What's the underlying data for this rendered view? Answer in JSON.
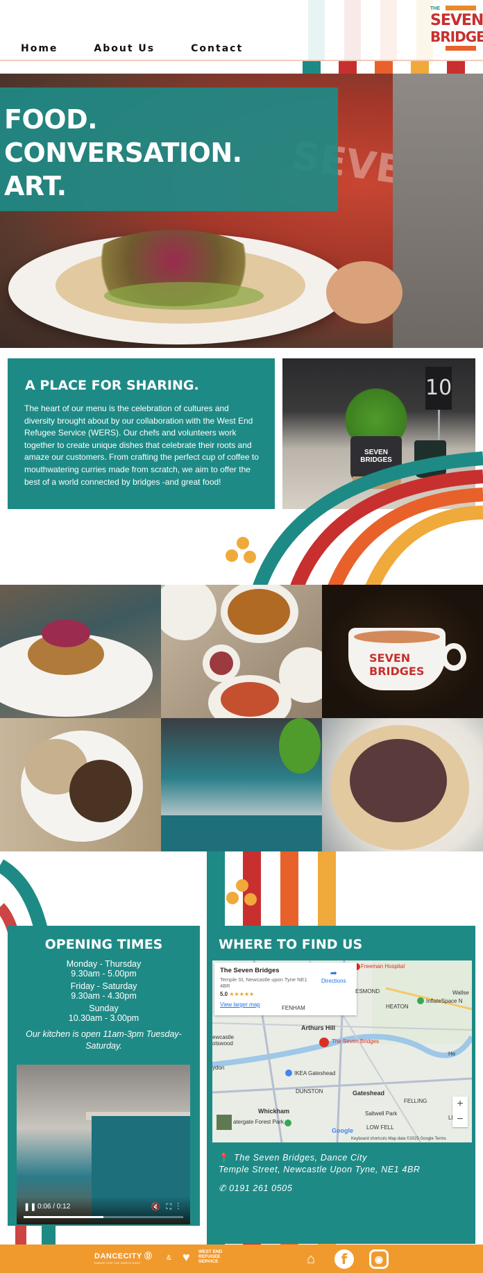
{
  "nav": {
    "items": [
      "Home",
      "About Us",
      "Contact"
    ]
  },
  "logo": {
    "small": "THE",
    "line1": "SEVEN",
    "line2": "BRIDGES"
  },
  "hero": {
    "lines": [
      "FOOD.",
      "CONVERSATION.",
      "ART."
    ],
    "apron_text": "SEVEN"
  },
  "sharing": {
    "title": "A PLACE FOR SHARING.",
    "body": "The heart of our menu is the celebration of cultures and diversity brought about by our collaboration with the West End Refugee Service (WERS). Our chefs and volunteers work together to create unique dishes that celebrate their roots and amaze our customers. From crafting the perfect cup of coffee to mouthwatering curries made from scratch, we aim to offer the best of a world connected by bridges -and great food!",
    "table_number": "10",
    "pot_label": "SEVEN BRIDGES"
  },
  "gallery": {
    "mug_text": "SEVEN BRIDGES"
  },
  "opening": {
    "title": "OPENING TIMES",
    "rows": [
      {
        "days": "Monday - Thursday",
        "hours": "9.30am - 5.00pm"
      },
      {
        "days": "Friday - Saturday",
        "hours": "9.30am - 4.30pm"
      },
      {
        "days": "Sunday",
        "hours": "10.30am - 3.00pm"
      }
    ],
    "note": "Our kitchen is open 11am-3pm Tuesday-Saturday.",
    "video": {
      "time": "0:06 / 0:12",
      "progress": 0.5
    }
  },
  "where": {
    "title": "WHERE TO FIND US",
    "map": {
      "place_name": "The Seven Bridges",
      "place_address": "Temple St, Newcastle upon Tyne NE1 4BR",
      "rating": "5.0",
      "stars": "★★★★★",
      "larger_map": "View larger map",
      "directions": "Directions",
      "labels": {
        "hospital": "Freeman Hospital",
        "jesmond": "ESMOND",
        "wallsend": "Wallse",
        "inflate": "InflateSpace N",
        "heaton": "HEATON",
        "fenham": "FENHAM",
        "arthurs_hill": "Arthurs Hill",
        "seven_bridges": "The Seven Bridges",
        "newcastle": "ewcastle\notswood",
        "ikea": "IKEA Gateshead",
        "ydon": "ydon",
        "dunston": "DUNSTON",
        "gateshead": "Gateshead",
        "felling": "FELLING",
        "whickham": "Whickham",
        "saltwell": "Saltwell Park",
        "forest": "atergate Forest Park",
        "low_fell": "LOW FELL",
        "he": "He",
        "leam": "LEAM"
      },
      "google": "Google",
      "footer": "Keyboard shortcuts   Map data ©2025 Google   Terms"
    },
    "address_line1": "The Seven Bridges, Dance City",
    "address_line2": "Temple Street, Newcastle Upon Tyne, NE1 4BR",
    "phone": "0191 261 0505"
  },
  "footer": {
    "dancecity": "DANCECITY",
    "dancecity_sub": "DANCE FOR THE NORTH EAST",
    "amp": "&",
    "wers": "WEST END\nREFUGEE\nSERVICE"
  },
  "colors": {
    "teal": "#1e8a86",
    "red": "#c7302f",
    "orange": "#f09a2e",
    "dark_orange": "#e8612b",
    "yellow": "#f0a93b"
  }
}
